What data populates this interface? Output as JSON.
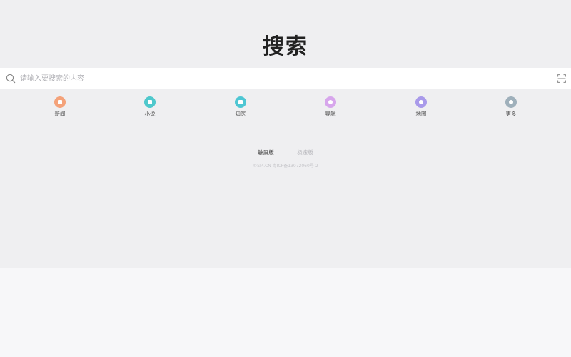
{
  "logo": {
    "text": "搜索"
  },
  "search": {
    "placeholder": "请输入要搜索的内容",
    "value": ""
  },
  "nav": {
    "items": [
      {
        "label": "新闻",
        "color": "#f4a27a",
        "icon": "news-icon"
      },
      {
        "label": "小说",
        "color": "#4fc8cc",
        "icon": "novel-icon"
      },
      {
        "label": "知医",
        "color": "#4ec6d3",
        "icon": "medical-icon"
      },
      {
        "label": "导航",
        "color": "#d7a6ec",
        "icon": "navigation-icon"
      },
      {
        "label": "地图",
        "color": "#a99aea",
        "icon": "map-icon"
      },
      {
        "label": "更多",
        "color": "#9fb0bb",
        "icon": "more-icon"
      }
    ]
  },
  "footer": {
    "links": [
      {
        "label": "触屏版"
      },
      {
        "label": "极速版"
      }
    ],
    "icp": "©SM.CN 粤ICP备13072060号-2"
  }
}
